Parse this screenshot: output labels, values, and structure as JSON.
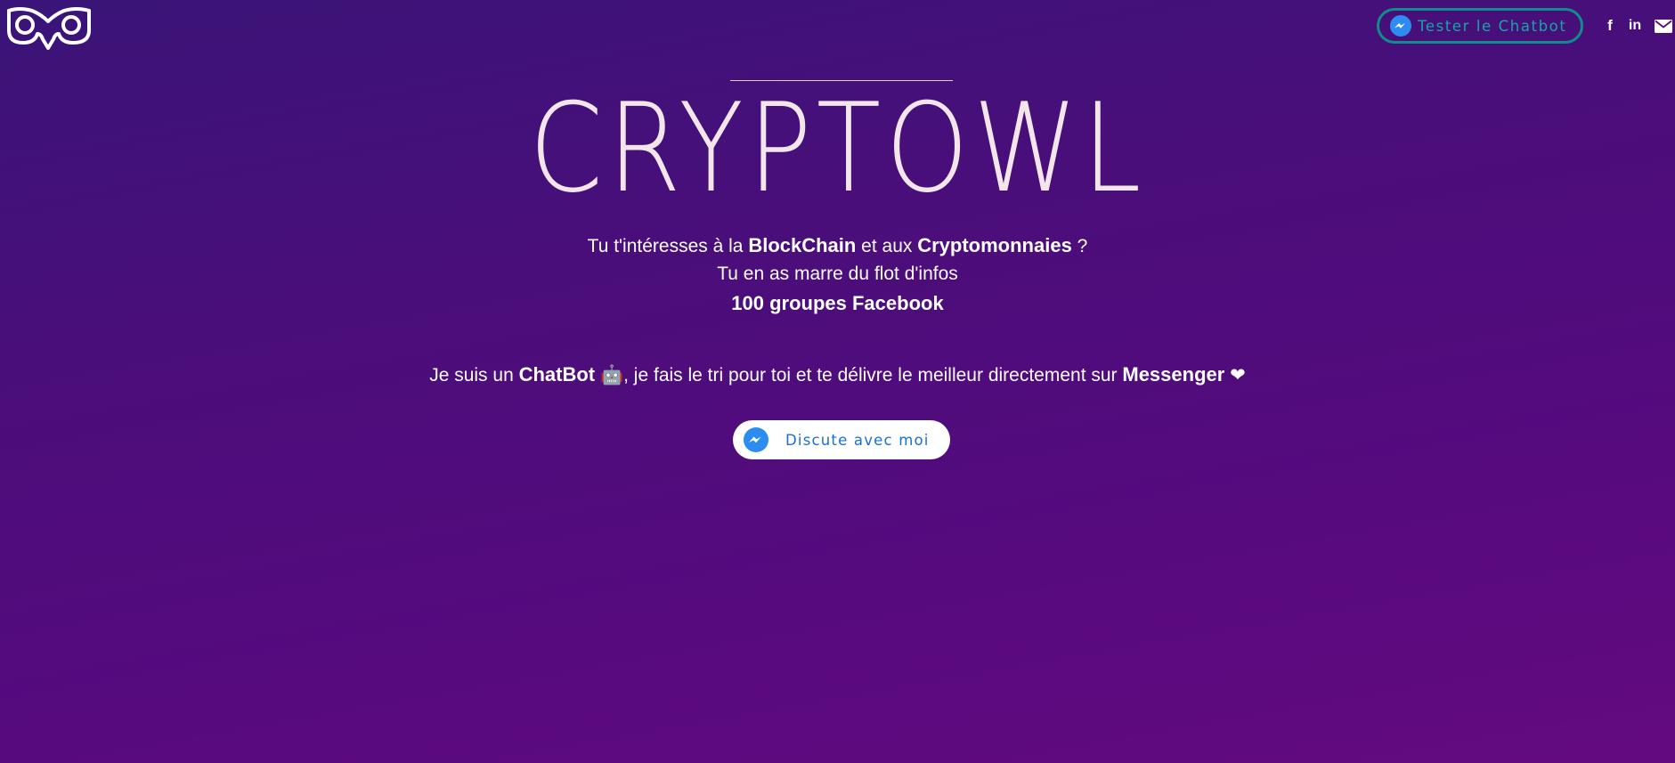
{
  "header": {
    "tester_button_label": "Tester le Chatbot",
    "social": {
      "facebook_glyph": "f",
      "linkedin_glyph": "in"
    }
  },
  "hero": {
    "brand_title": "CRYPTOWL",
    "line1_prefix": "Tu t'intéresses à la ",
    "line1_bold1": "BlockChain",
    "line1_mid": " et aux ",
    "line1_bold2": "Cryptomonnaies",
    "line1_suffix": " ?",
    "line2": "Tu en as marre du flot d'infos",
    "line3": "100 groupes Facebook",
    "line4_prefix": "Je suis un ",
    "line4_bold1": "ChatBot",
    "line4_robot": "🤖",
    "line4_mid": ", je fais le tri pour toi et te délivre le meilleur directement sur ",
    "line4_bold2": "Messenger",
    "line4_heart": "❤",
    "cta_label": "Discute avec moi"
  },
  "icons": {
    "logo": "owl-logo-icon",
    "messenger": "messenger-icon",
    "facebook": "facebook-icon",
    "linkedin": "linkedin-icon",
    "mail": "mail-icon"
  },
  "colors": {
    "background_top": "#3a1478",
    "background_bottom": "#640a80",
    "accent_teal": "#14a6a6",
    "messenger_blue": "#1a6fd4",
    "brand_text": "#f3e6ea"
  }
}
